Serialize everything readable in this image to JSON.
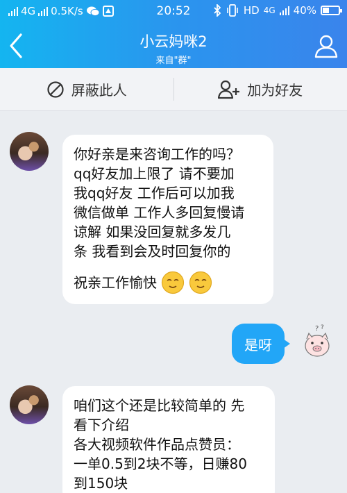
{
  "status_bar": {
    "network": "4G",
    "speed": "0.5K/s",
    "time": "20:52",
    "hd": "HD",
    "network2": "4G",
    "battery_text": "40%",
    "battery_level": 0.4
  },
  "header": {
    "title": "小云妈咪2",
    "subtitle": "来自\"群\""
  },
  "actions": {
    "block_label": "屏蔽此人",
    "add_friend_label": "加为好友"
  },
  "messages": [
    {
      "direction": "incoming",
      "lines": [
        "你好亲是来咨询工作的吗？",
        "qq好友加上限了 请不要加",
        "我qq好友 工作后可以加我",
        "微信做单 工作人多回复慢请",
        "谅解  如果没回复就多发几",
        "条 我看到会及时回复你的"
      ],
      "tail_text": "祝亲工作愉快",
      "emoji": "smiling-face-icon"
    },
    {
      "direction": "outgoing",
      "text": "是呀"
    },
    {
      "direction": "incoming",
      "lines": [
        "咱们这个还是比较简单的 先",
        "看下介绍",
        "各大视频软件作品点赞员：",
        "一单0.5到2块不等，日赚80",
        "到150块"
      ]
    }
  ],
  "colors": {
    "header_start": "#14b5f0",
    "header_end": "#3a84ec",
    "outgoing_bubble": "#22a6f7",
    "incoming_bubble": "#ffffff",
    "background": "#eaedf1"
  }
}
